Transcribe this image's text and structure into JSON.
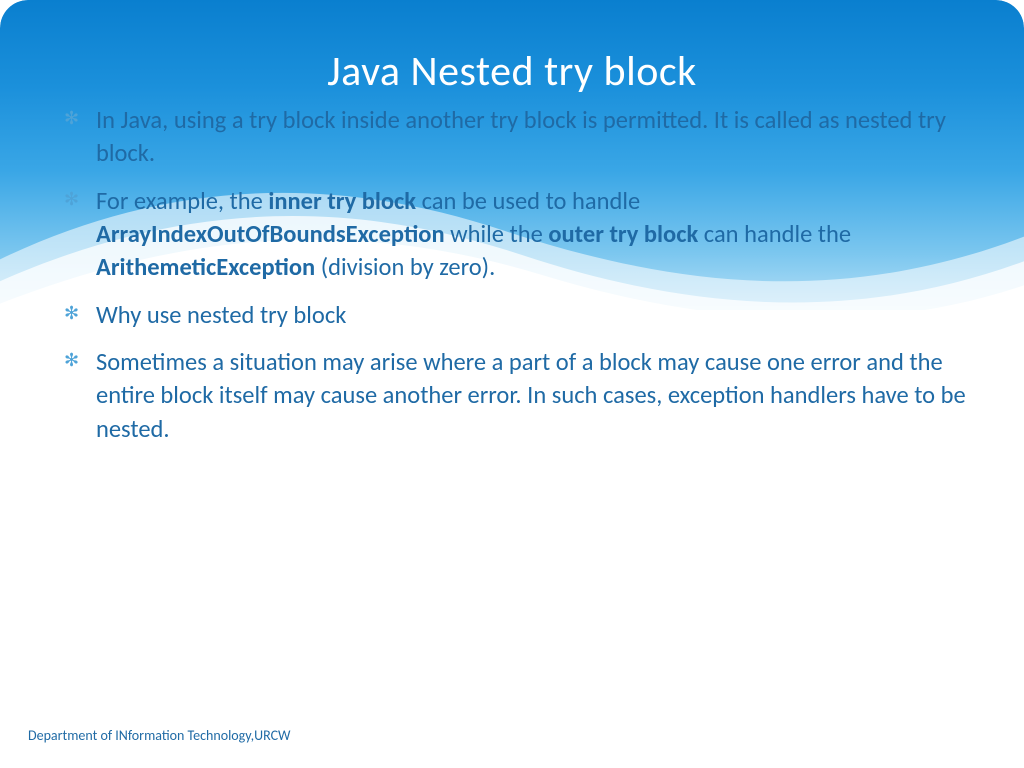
{
  "slide": {
    "title": "Java Nested try block",
    "bullets": [
      {
        "segments": [
          {
            "text": "In Java, using a try block inside another try block is permitted. It is called as nested try block.",
            "bold": false
          }
        ]
      },
      {
        "segments": [
          {
            "text": "For example, the ",
            "bold": false
          },
          {
            "text": "inner try block",
            "bold": true
          },
          {
            "text": " can be used to handle ",
            "bold": false
          },
          {
            "text": "ArrayIndexOutOfBoundsException",
            "bold": true
          },
          {
            "text": " while the ",
            "bold": false
          },
          {
            "text": "outer try block",
            "bold": true
          },
          {
            "text": " can handle the ",
            "bold": false
          },
          {
            "text": "ArithemeticException",
            "bold": true
          },
          {
            "text": " (division by zero).",
            "bold": false
          }
        ]
      },
      {
        "segments": [
          {
            "text": "Why use nested try block",
            "bold": false
          }
        ]
      },
      {
        "segments": [
          {
            "text": "Sometimes a situation may arise where a part of a block may cause one error and the entire block itself may cause another error. In such cases, exception handlers have to be nested.",
            "bold": false
          }
        ]
      }
    ],
    "footer": "Department of INformation Technology,URCW"
  },
  "colors": {
    "text": "#1f6aa5",
    "title": "#ffffff",
    "sky_top": "#0a7fcf",
    "sky_bottom": "#b7e0f6"
  }
}
